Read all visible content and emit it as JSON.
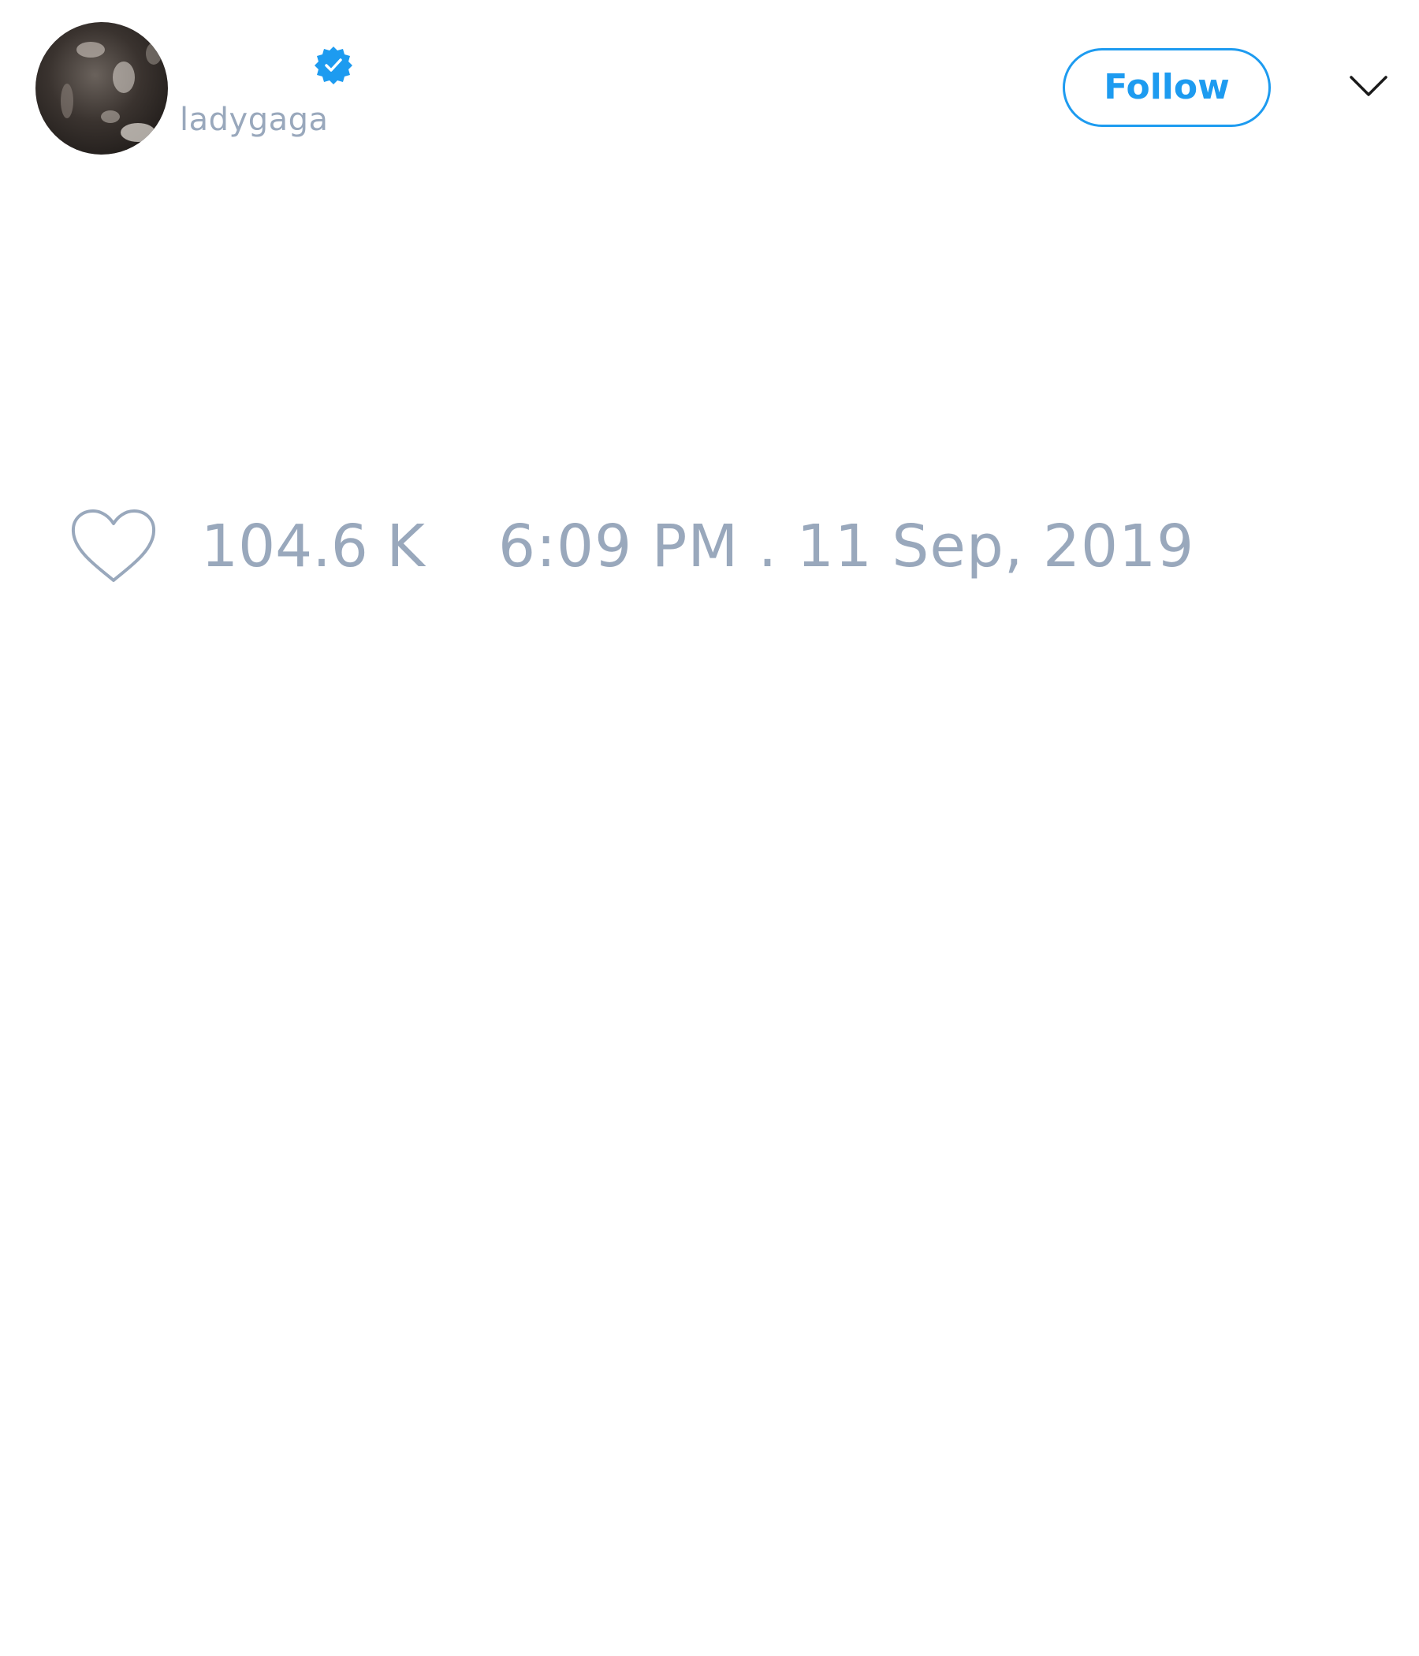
{
  "tweet": {
    "author": {
      "handle": "ladygaga",
      "verified": true,
      "avatar_icon": "profile-photo"
    },
    "follow_label": "Follow",
    "menu_icon": "chevron-down-icon",
    "likes": "104.6 K",
    "like_icon": "heart-outline-icon",
    "timestamp": "6:09 PM . 11 Sep, 2019"
  },
  "colors": {
    "accent": "#1d9bf0",
    "muted_text": "#99a8bc",
    "background": "#ffffff"
  }
}
